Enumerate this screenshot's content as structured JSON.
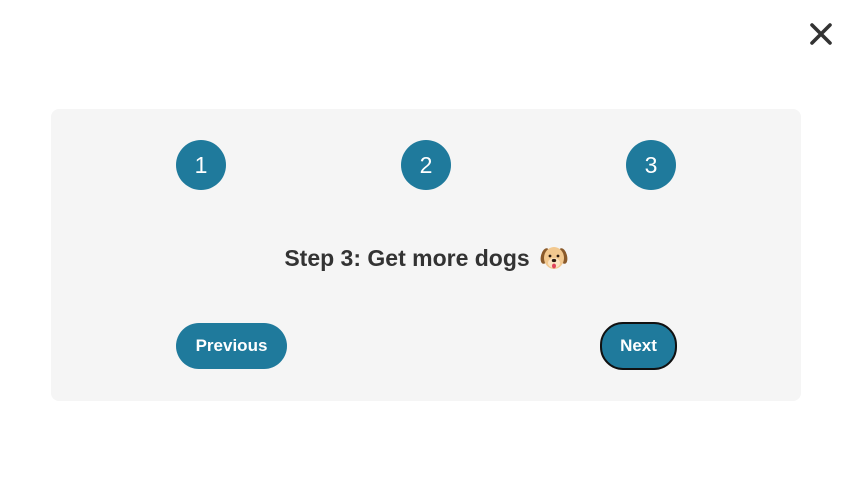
{
  "close": {
    "icon": "close-icon"
  },
  "steps": [
    {
      "number": "1"
    },
    {
      "number": "2"
    },
    {
      "number": "3"
    }
  ],
  "content": {
    "title": "Step 3: Get more dogs",
    "emoji": "dog-face-icon"
  },
  "buttons": {
    "previous_label": "Previous",
    "next_label": "Next"
  },
  "colors": {
    "accent": "#1f7a9c",
    "panel_bg": "#f5f5f5",
    "text": "#333333"
  }
}
